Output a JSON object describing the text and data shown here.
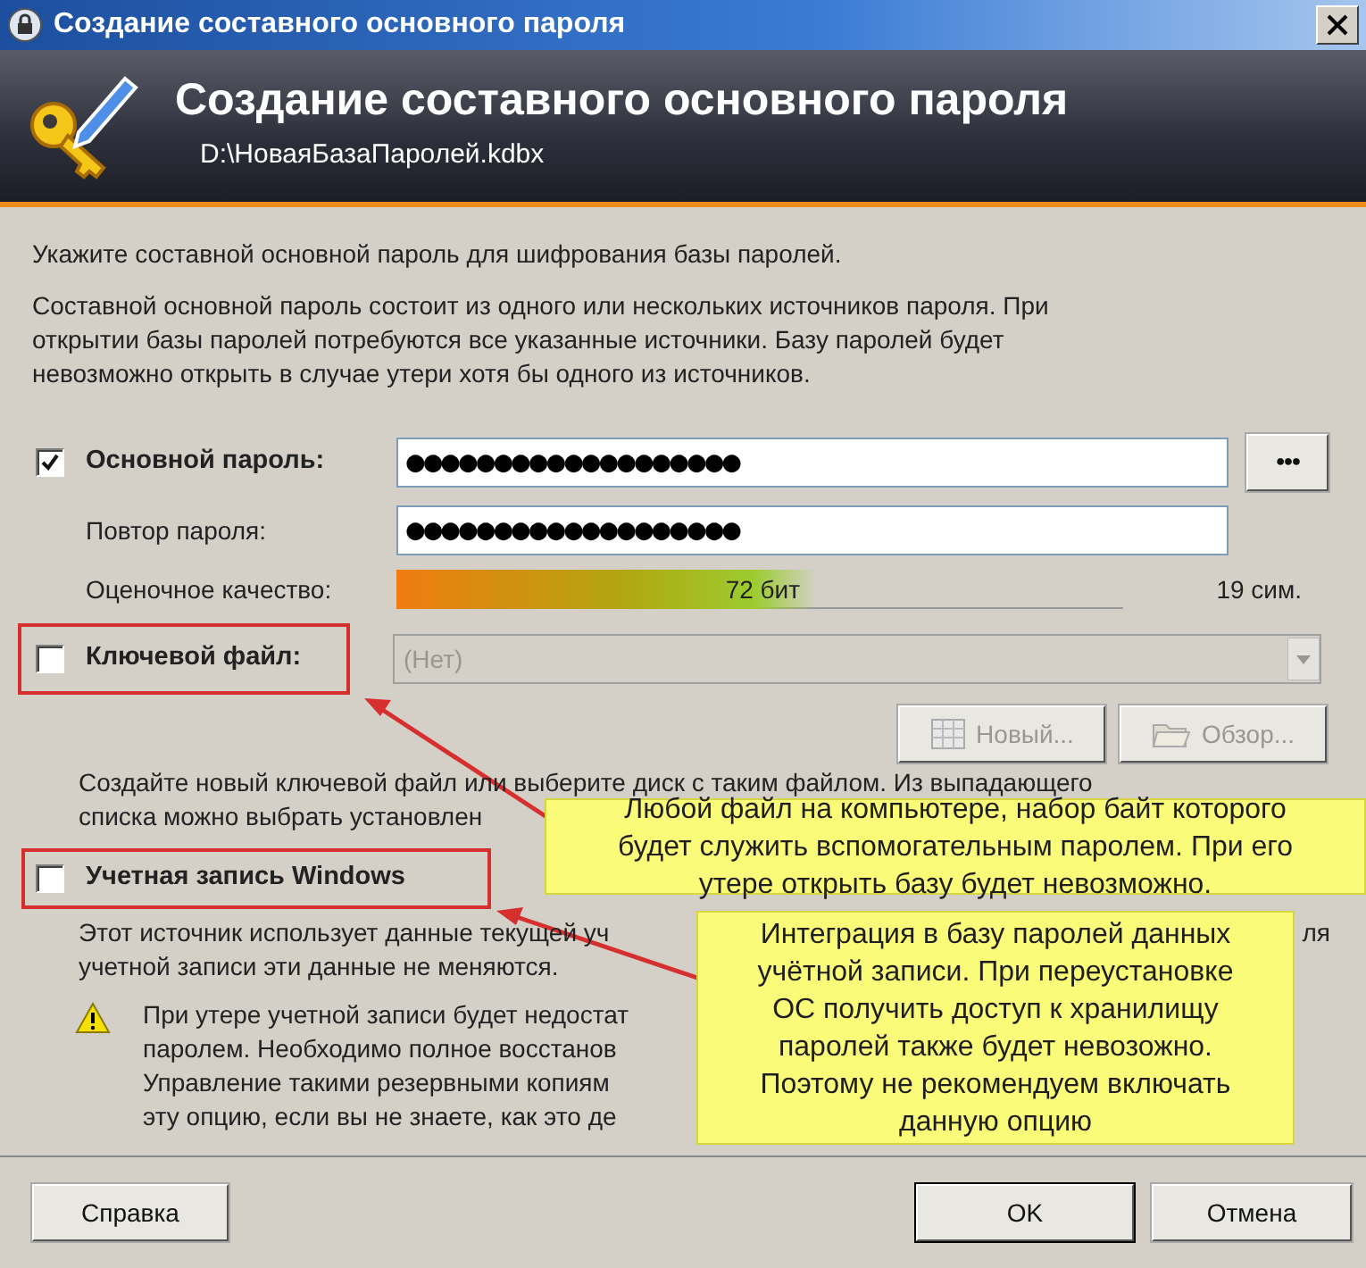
{
  "window": {
    "title": "Создание составного основного пароля"
  },
  "banner": {
    "title": "Создание составного основного пароля",
    "subtitle": "D:\\НоваяБазаПаролей.kdbx"
  },
  "intro": "Укажите составной основной пароль для шифрования базы паролей.",
  "description_lines": [
    "Составной основной пароль состоит из одного или нескольких источников пароля. При",
    "открытии базы паролей потребуются все указанные источники. Базу паролей будет",
    "невозможно открыть в случае утери хотя бы одного из источников."
  ],
  "master_password": {
    "checked": true,
    "label": "Основной пароль:",
    "value": "●●●●●●●●●●●●●●●●●●●",
    "show_button": "●●●"
  },
  "repeat_password": {
    "label": "Повтор пароля:",
    "value": "●●●●●●●●●●●●●●●●●●●"
  },
  "quality": {
    "label": "Оценочное качество:",
    "level": 0.58,
    "reading": "72 бит",
    "count": "19 сим."
  },
  "key_file": {
    "checked": false,
    "label": "Ключевой файл:",
    "value": "(Нет)",
    "disabled": true,
    "buttons": [
      {
        "label": "Новый...",
        "disabled": true
      },
      {
        "label": "Обзор...",
        "disabled": true
      }
    ],
    "description_lines": [
      "Создайте новый ключевой файл или выберите диск с таким файлом. Из выпадающего",
      "списка можно выбрать установлен"
    ]
  },
  "windows_account": {
    "checked": false,
    "label": "Учетная запись Windows",
    "description_lines": [
      "Этот источник использует данные текущей уч",
      "учетной записи эти данные не меняются."
    ],
    "description_tail": "ля",
    "warning_lines": [
      "При утере учетной записи будет недостат",
      "паролем. Необходимо полное восстанов",
      "Управление такими резервными копиям",
      "эту опцию, если вы не знаете, как это де"
    ]
  },
  "callouts": [
    {
      "text": "Любой файл на компьютере, набор байт которого будет служить вспомогательным паролем. При его утере открыть базу будет невозможно."
    },
    {
      "text": "Интеграция в базу паролей данных учётной записи. При переустановке ОС получить доступ к хранилищу паролей также будет невозожно. Поэтому не рекомендуем включать данную опцию"
    }
  ],
  "footer": {
    "help": "Справка",
    "ok": "OK",
    "cancel": "Отмена"
  }
}
